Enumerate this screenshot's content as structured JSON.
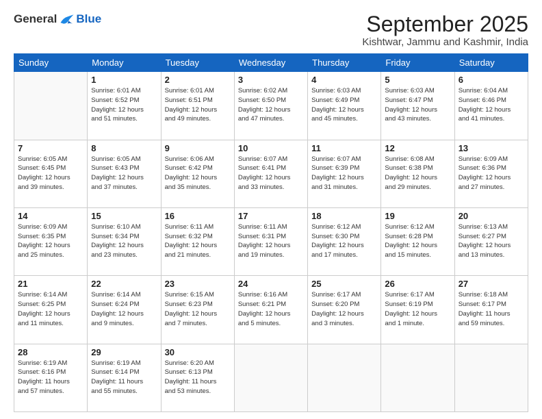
{
  "logo": {
    "general": "General",
    "blue": "Blue"
  },
  "title": "September 2025",
  "subtitle": "Kishtwar, Jammu and Kashmir, India",
  "weekdays": [
    "Sunday",
    "Monday",
    "Tuesday",
    "Wednesday",
    "Thursday",
    "Friday",
    "Saturday"
  ],
  "weeks": [
    [
      {
        "day": "",
        "info": ""
      },
      {
        "day": "1",
        "info": "Sunrise: 6:01 AM\nSunset: 6:52 PM\nDaylight: 12 hours\nand 51 minutes."
      },
      {
        "day": "2",
        "info": "Sunrise: 6:01 AM\nSunset: 6:51 PM\nDaylight: 12 hours\nand 49 minutes."
      },
      {
        "day": "3",
        "info": "Sunrise: 6:02 AM\nSunset: 6:50 PM\nDaylight: 12 hours\nand 47 minutes."
      },
      {
        "day": "4",
        "info": "Sunrise: 6:03 AM\nSunset: 6:49 PM\nDaylight: 12 hours\nand 45 minutes."
      },
      {
        "day": "5",
        "info": "Sunrise: 6:03 AM\nSunset: 6:47 PM\nDaylight: 12 hours\nand 43 minutes."
      },
      {
        "day": "6",
        "info": "Sunrise: 6:04 AM\nSunset: 6:46 PM\nDaylight: 12 hours\nand 41 minutes."
      }
    ],
    [
      {
        "day": "7",
        "info": "Sunrise: 6:05 AM\nSunset: 6:45 PM\nDaylight: 12 hours\nand 39 minutes."
      },
      {
        "day": "8",
        "info": "Sunrise: 6:05 AM\nSunset: 6:43 PM\nDaylight: 12 hours\nand 37 minutes."
      },
      {
        "day": "9",
        "info": "Sunrise: 6:06 AM\nSunset: 6:42 PM\nDaylight: 12 hours\nand 35 minutes."
      },
      {
        "day": "10",
        "info": "Sunrise: 6:07 AM\nSunset: 6:41 PM\nDaylight: 12 hours\nand 33 minutes."
      },
      {
        "day": "11",
        "info": "Sunrise: 6:07 AM\nSunset: 6:39 PM\nDaylight: 12 hours\nand 31 minutes."
      },
      {
        "day": "12",
        "info": "Sunrise: 6:08 AM\nSunset: 6:38 PM\nDaylight: 12 hours\nand 29 minutes."
      },
      {
        "day": "13",
        "info": "Sunrise: 6:09 AM\nSunset: 6:36 PM\nDaylight: 12 hours\nand 27 minutes."
      }
    ],
    [
      {
        "day": "14",
        "info": "Sunrise: 6:09 AM\nSunset: 6:35 PM\nDaylight: 12 hours\nand 25 minutes."
      },
      {
        "day": "15",
        "info": "Sunrise: 6:10 AM\nSunset: 6:34 PM\nDaylight: 12 hours\nand 23 minutes."
      },
      {
        "day": "16",
        "info": "Sunrise: 6:11 AM\nSunset: 6:32 PM\nDaylight: 12 hours\nand 21 minutes."
      },
      {
        "day": "17",
        "info": "Sunrise: 6:11 AM\nSunset: 6:31 PM\nDaylight: 12 hours\nand 19 minutes."
      },
      {
        "day": "18",
        "info": "Sunrise: 6:12 AM\nSunset: 6:30 PM\nDaylight: 12 hours\nand 17 minutes."
      },
      {
        "day": "19",
        "info": "Sunrise: 6:12 AM\nSunset: 6:28 PM\nDaylight: 12 hours\nand 15 minutes."
      },
      {
        "day": "20",
        "info": "Sunrise: 6:13 AM\nSunset: 6:27 PM\nDaylight: 12 hours\nand 13 minutes."
      }
    ],
    [
      {
        "day": "21",
        "info": "Sunrise: 6:14 AM\nSunset: 6:25 PM\nDaylight: 12 hours\nand 11 minutes."
      },
      {
        "day": "22",
        "info": "Sunrise: 6:14 AM\nSunset: 6:24 PM\nDaylight: 12 hours\nand 9 minutes."
      },
      {
        "day": "23",
        "info": "Sunrise: 6:15 AM\nSunset: 6:23 PM\nDaylight: 12 hours\nand 7 minutes."
      },
      {
        "day": "24",
        "info": "Sunrise: 6:16 AM\nSunset: 6:21 PM\nDaylight: 12 hours\nand 5 minutes."
      },
      {
        "day": "25",
        "info": "Sunrise: 6:17 AM\nSunset: 6:20 PM\nDaylight: 12 hours\nand 3 minutes."
      },
      {
        "day": "26",
        "info": "Sunrise: 6:17 AM\nSunset: 6:19 PM\nDaylight: 12 hours\nand 1 minute."
      },
      {
        "day": "27",
        "info": "Sunrise: 6:18 AM\nSunset: 6:17 PM\nDaylight: 11 hours\nand 59 minutes."
      }
    ],
    [
      {
        "day": "28",
        "info": "Sunrise: 6:19 AM\nSunset: 6:16 PM\nDaylight: 11 hours\nand 57 minutes."
      },
      {
        "day": "29",
        "info": "Sunrise: 6:19 AM\nSunset: 6:14 PM\nDaylight: 11 hours\nand 55 minutes."
      },
      {
        "day": "30",
        "info": "Sunrise: 6:20 AM\nSunset: 6:13 PM\nDaylight: 11 hours\nand 53 minutes."
      },
      {
        "day": "",
        "info": ""
      },
      {
        "day": "",
        "info": ""
      },
      {
        "day": "",
        "info": ""
      },
      {
        "day": "",
        "info": ""
      }
    ]
  ]
}
